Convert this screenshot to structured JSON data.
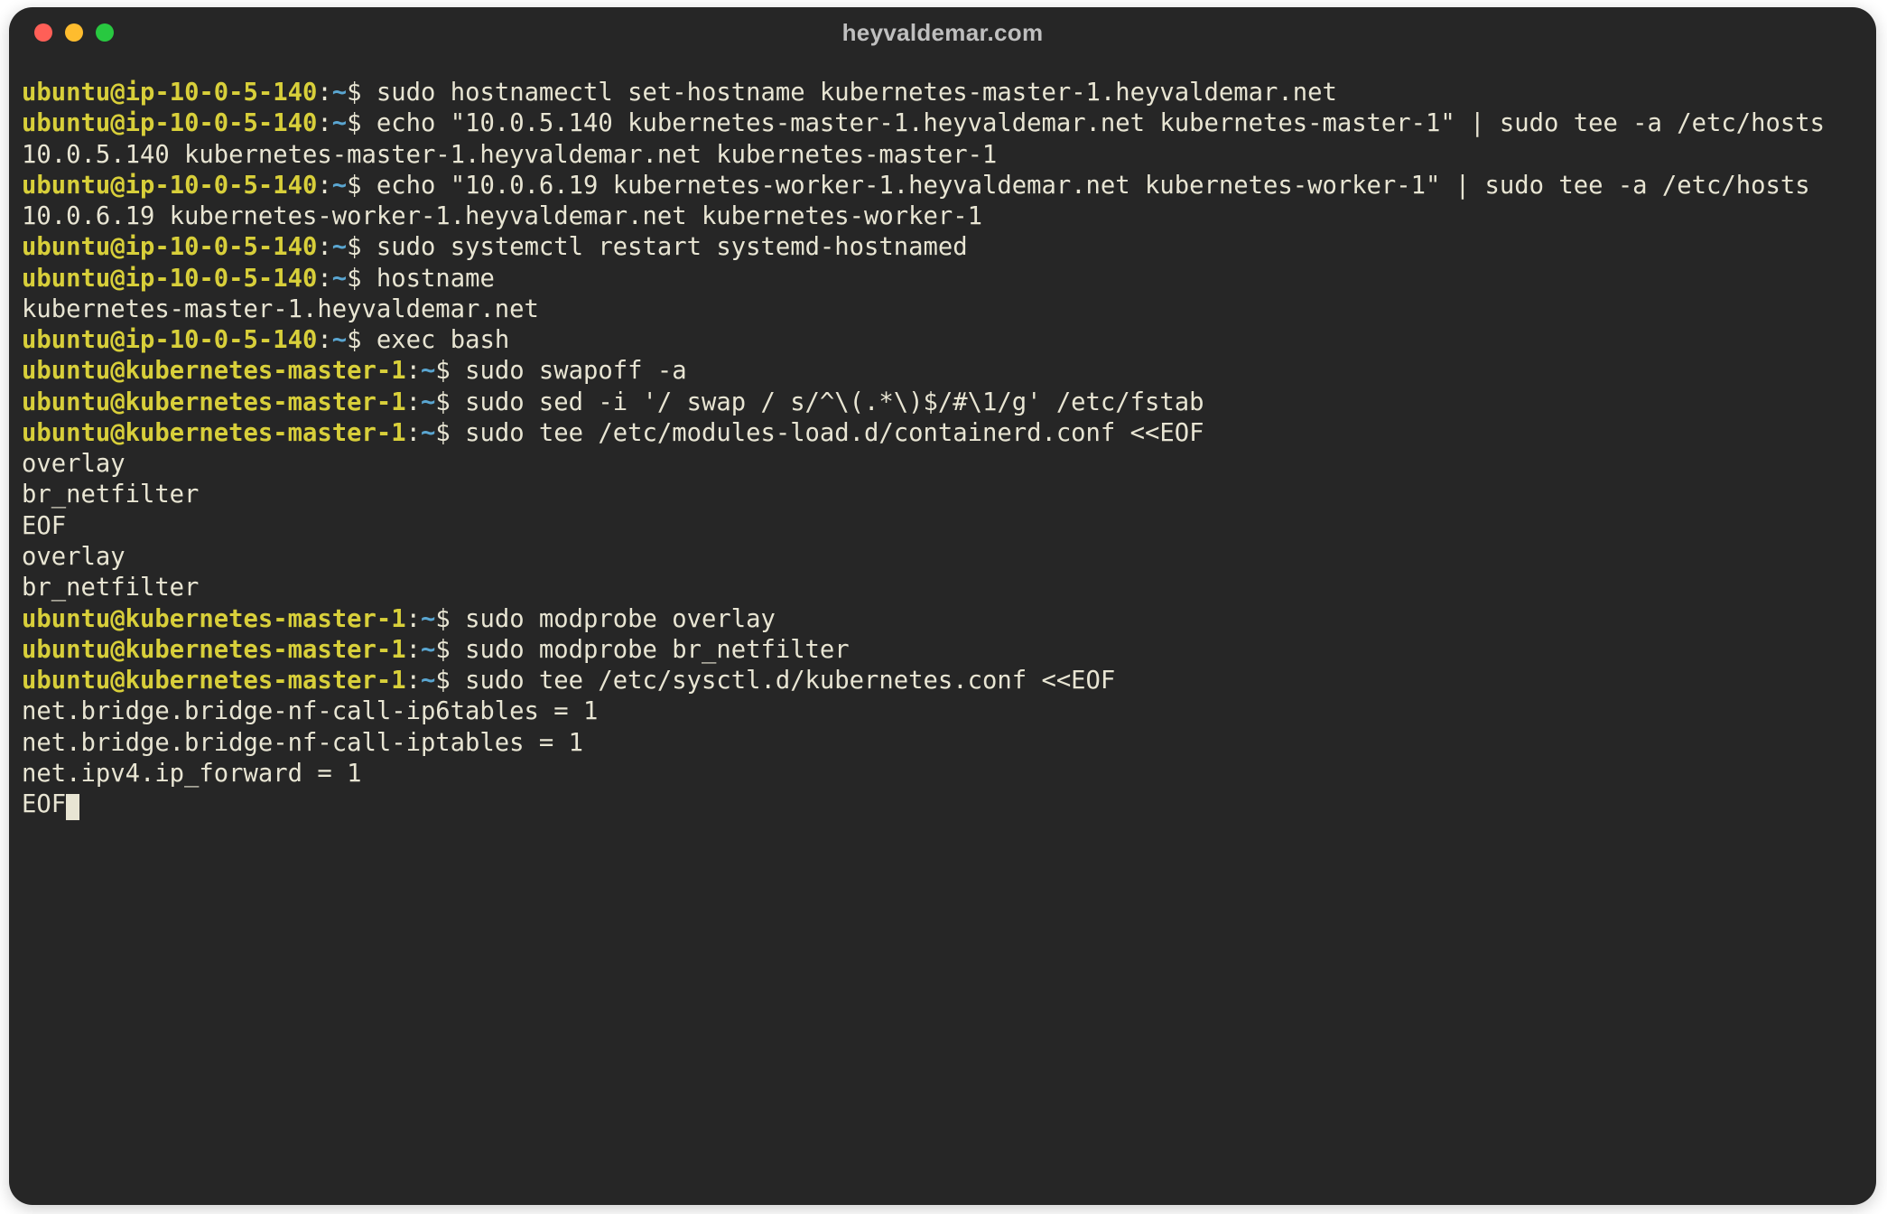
{
  "window": {
    "title": "heyvaldemar.com"
  },
  "prompts": {
    "ip": {
      "user": "ubuntu",
      "at": "@",
      "host": "ip-10-0-5-140",
      "colon": ":",
      "path": "~",
      "dollar": "$"
    },
    "km": {
      "user": "ubuntu",
      "at": "@",
      "host": "kubernetes-master-1",
      "colon": ":",
      "path": "~",
      "dollar": "$"
    }
  },
  "lines": [
    {
      "t": "cmd",
      "p": "ip",
      "text": " sudo hostnamectl set-hostname kubernetes-master-1.heyvaldemar.net"
    },
    {
      "t": "cmd",
      "p": "ip",
      "text": " echo \"10.0.5.140 kubernetes-master-1.heyvaldemar.net kubernetes-master-1\" | sudo tee -a /etc/hosts"
    },
    {
      "t": "out",
      "text": "10.0.5.140 kubernetes-master-1.heyvaldemar.net kubernetes-master-1"
    },
    {
      "t": "cmd",
      "p": "ip",
      "text": " echo \"10.0.6.19 kubernetes-worker-1.heyvaldemar.net kubernetes-worker-1\" | sudo tee -a /etc/hosts"
    },
    {
      "t": "out",
      "text": "10.0.6.19 kubernetes-worker-1.heyvaldemar.net kubernetes-worker-1"
    },
    {
      "t": "cmd",
      "p": "ip",
      "text": " sudo systemctl restart systemd-hostnamed"
    },
    {
      "t": "cmd",
      "p": "ip",
      "text": " hostname"
    },
    {
      "t": "out",
      "text": "kubernetes-master-1.heyvaldemar.net"
    },
    {
      "t": "cmd",
      "p": "ip",
      "text": " exec bash"
    },
    {
      "t": "cmd",
      "p": "km",
      "text": " sudo swapoff -a"
    },
    {
      "t": "cmd",
      "p": "km",
      "text": " sudo sed -i '/ swap / s/^\\(.*\\)$/#\\1/g' /etc/fstab"
    },
    {
      "t": "cmd",
      "p": "km",
      "text": " sudo tee /etc/modules-load.d/containerd.conf <<EOF"
    },
    {
      "t": "out",
      "text": "overlay"
    },
    {
      "t": "out",
      "text": "br_netfilter"
    },
    {
      "t": "out",
      "text": "EOF"
    },
    {
      "t": "out",
      "text": "overlay"
    },
    {
      "t": "out",
      "text": "br_netfilter"
    },
    {
      "t": "cmd",
      "p": "km",
      "text": " sudo modprobe overlay"
    },
    {
      "t": "cmd",
      "p": "km",
      "text": " sudo modprobe br_netfilter"
    },
    {
      "t": "cmd",
      "p": "km",
      "text": " sudo tee /etc/sysctl.d/kubernetes.conf <<EOF"
    },
    {
      "t": "out",
      "text": "net.bridge.bridge-nf-call-ip6tables = 1"
    },
    {
      "t": "out",
      "text": "net.bridge.bridge-nf-call-iptables = 1"
    },
    {
      "t": "out",
      "text": "net.ipv4.ip_forward = 1"
    },
    {
      "t": "out",
      "text": "EOF",
      "cursor": true
    }
  ]
}
